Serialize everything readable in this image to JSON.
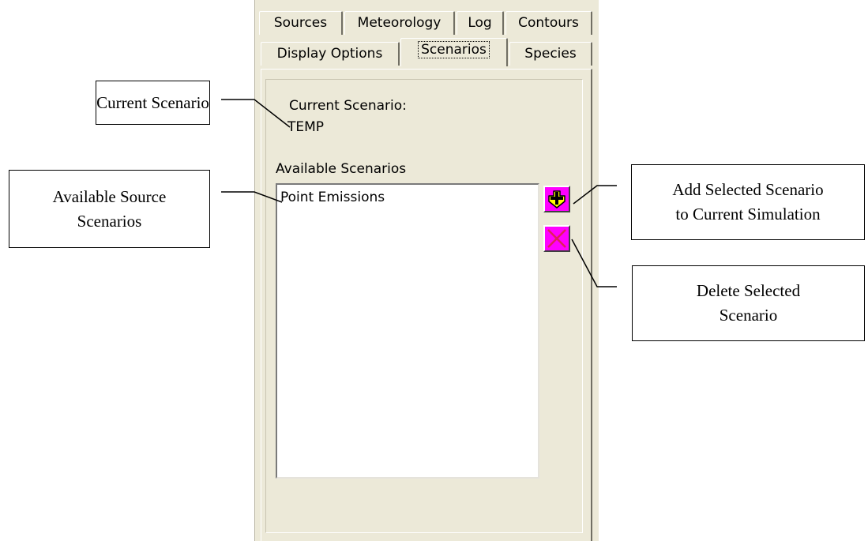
{
  "tabs_row1": [
    "Sources",
    "Meteorology",
    "Log",
    "Contours"
  ],
  "tabs_row2": [
    "Display Options",
    "Scenarios",
    "Species"
  ],
  "active_tab": "Scenarios",
  "current_scenario": {
    "label": "Current Scenario:",
    "value": "TEMP"
  },
  "available_scenarios": {
    "label": "Available Scenarios",
    "items": [
      "Point Emissions"
    ]
  },
  "buttons": {
    "add_icon": "plus-icon",
    "delete_icon": "x-delete-icon",
    "colors": {
      "button_bg": "#ff00ff",
      "plus_fill": "#ffff00",
      "x_stroke": "#e0205a"
    }
  },
  "callouts": {
    "current_scenario": "Current Scenario",
    "available_line1": "Available Source",
    "available_line2": "Scenarios",
    "add_line1": "Add Selected Scenario",
    "add_line2": "to Current Simulation",
    "delete_line1": "Delete Selected",
    "delete_line2": "Scenario"
  }
}
